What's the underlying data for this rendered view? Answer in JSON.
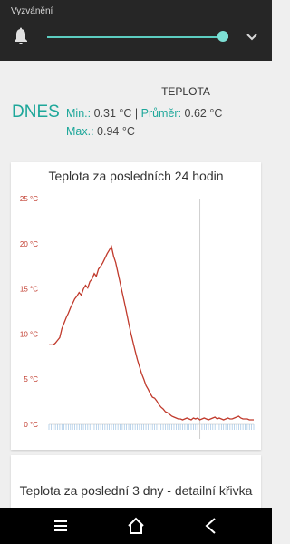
{
  "volume_panel": {
    "title": "Vyzvánění",
    "level_percent": 97,
    "accent": "#5ccdc0"
  },
  "summary": {
    "heading": "TEPLOTA",
    "today_label": "DNES",
    "min_label": "Min.:",
    "min_value": "0.31 °C",
    "separator": " | ",
    "avg_label": "Průměr:",
    "avg_value": "0.62 °C",
    "max_label": "Max.:",
    "max_value": "0.94 °C",
    "accent": "#1ea79a"
  },
  "chart_card": {
    "title": "Teplota za posledních 24 hodin"
  },
  "second_card": {
    "title": "Teplota za poslední 3 dny - detailní křivka"
  },
  "navbar": {
    "icons": [
      "menu-icon",
      "home-icon",
      "back-icon"
    ]
  },
  "chart_data": {
    "type": "line",
    "title": "Teplota za posledních 24 hodin",
    "xlabel": "",
    "ylabel": "",
    "ylim": [
      0,
      25
    ],
    "yticks": [
      "0 °C",
      "5 °C",
      "10 °C",
      "15 °C",
      "20 °C",
      "25 °C"
    ],
    "ytick_values": [
      0,
      5,
      10,
      15,
      20,
      25
    ],
    "grid": false,
    "line_color": "#c0392b",
    "series": [
      {
        "x": [
          0,
          1,
          2,
          3,
          4,
          5,
          6,
          7,
          8,
          9,
          10,
          11,
          12,
          13,
          14,
          15,
          16,
          17,
          18,
          19,
          20,
          21,
          22,
          23,
          24,
          25,
          26,
          27,
          28,
          29,
          30,
          31,
          32,
          33,
          34,
          35,
          36,
          37,
          38,
          39,
          40,
          41,
          42,
          43,
          44,
          45,
          46,
          47,
          48,
          49,
          50,
          51,
          52,
          53,
          54,
          55,
          56,
          57,
          58,
          59,
          60,
          61,
          62,
          63,
          64,
          65,
          66,
          67,
          68,
          69,
          70,
          71,
          72,
          73,
          74,
          75,
          76,
          77,
          78,
          79,
          80,
          81,
          82,
          83,
          84,
          85,
          86,
          87,
          88,
          89,
          90,
          91,
          92,
          93,
          94,
          95
        ],
        "values": [
          8.8,
          8.8,
          8.8,
          9.0,
          9.3,
          9.6,
          10.6,
          11.2,
          11.8,
          12.3,
          12.9,
          13.4,
          13.9,
          14.2,
          14.6,
          14.3,
          15.0,
          15.4,
          15.1,
          15.8,
          16.1,
          16.7,
          16.4,
          17.2,
          17.5,
          17.9,
          18.4,
          18.9,
          19.3,
          19.7,
          18.6,
          17.9,
          16.8,
          15.7,
          14.6,
          13.5,
          12.4,
          11.2,
          10.1,
          9.1,
          8.1,
          7.2,
          6.4,
          5.6,
          5.0,
          4.3,
          3.9,
          3.4,
          3.0,
          2.9,
          2.6,
          2.2,
          1.9,
          1.7,
          1.4,
          1.3,
          1.1,
          0.9,
          0.8,
          0.7,
          0.6,
          0.6,
          0.5,
          0.6,
          0.7,
          0.6,
          0.5,
          0.7,
          0.6,
          0.7,
          0.5,
          0.6,
          0.7,
          0.6,
          0.5,
          0.6,
          0.7,
          0.8,
          0.6,
          0.7,
          0.6,
          0.5,
          0.6,
          0.7,
          0.6,
          0.6,
          0.7,
          0.8,
          0.9,
          0.7,
          0.6,
          0.6,
          0.6,
          0.5,
          0.5,
          0.5
        ]
      }
    ],
    "vline_x": 70
  }
}
